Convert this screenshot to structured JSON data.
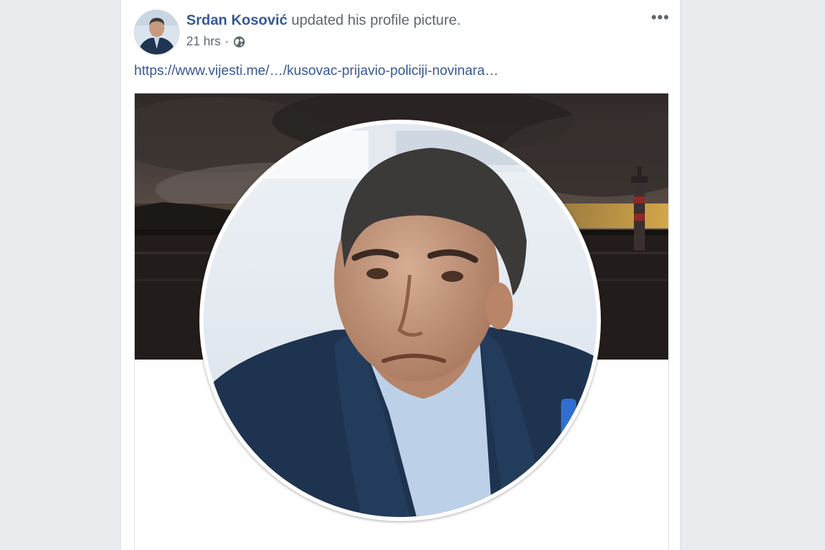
{
  "post": {
    "author": "Srdan Kosović",
    "action": "updated his profile picture.",
    "timestamp": "21 hrs",
    "separator": "·",
    "privacy_icon": "globe-icon",
    "more_icon": "ellipsis-icon",
    "link": "https://www.vijesti.me/…/kusovac-prijavio-policiji-novinara…"
  },
  "colors": {
    "link_blue": "#385898",
    "page_background": "#e9ebee",
    "card_background": "#ffffff"
  }
}
